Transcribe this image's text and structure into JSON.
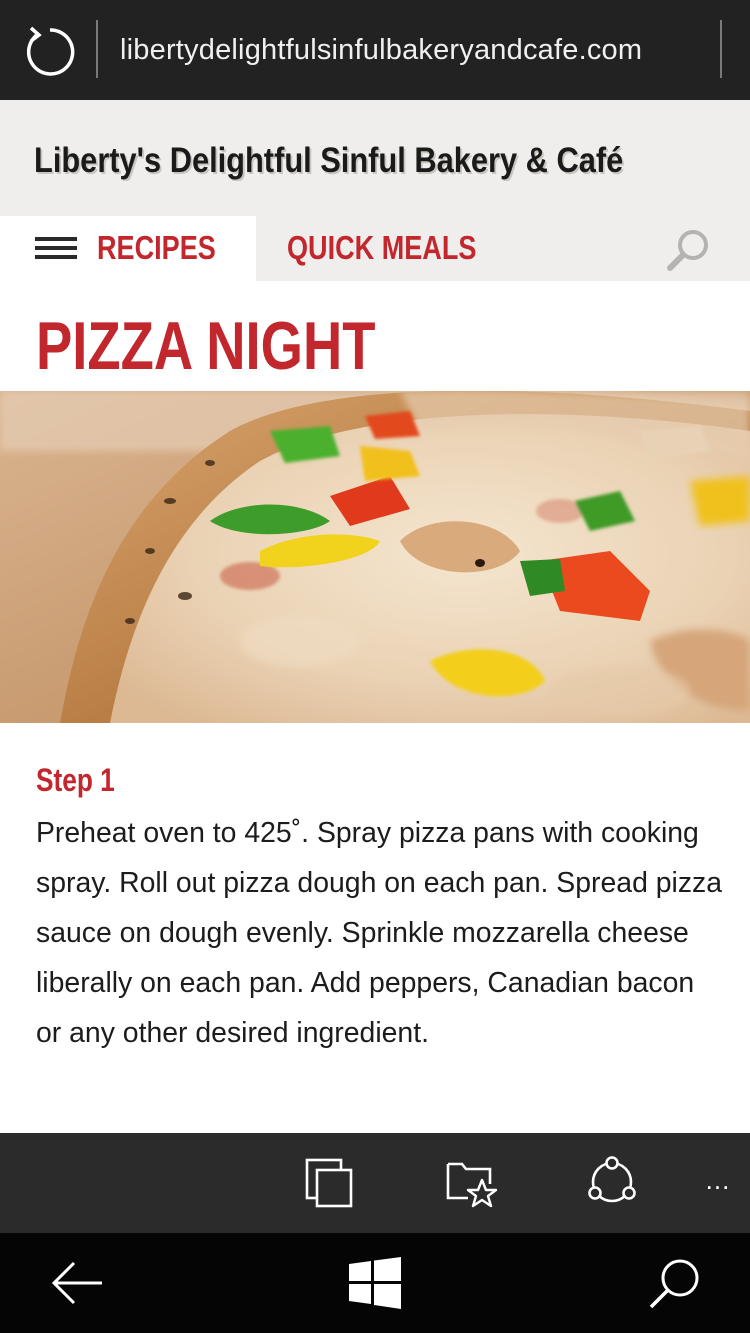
{
  "browser": {
    "url": "libertydelightfulsinfulbakeryandcafe.com"
  },
  "site": {
    "title": "Liberty's Delightful Sinful Bakery & Café"
  },
  "nav": {
    "items": [
      {
        "label": "RECIPES",
        "active": true
      },
      {
        "label": "QUICK MEALS",
        "active": false
      }
    ]
  },
  "page": {
    "title": "PIZZA NIGHT"
  },
  "steps": [
    {
      "heading": "Step 1",
      "text": "Preheat oven to 425˚. Spray pizza pans with cooking spray. Roll out pizza dough on each pan. Spread pizza sauce on dough evenly. Sprinkle mozzarella cheese liberally on each pan. Add peppers, Canadian bacon or any other desired ingredient."
    }
  ],
  "appbar": {
    "more_label": "..."
  },
  "icons": [
    "refresh-icon",
    "hamburger-menu-icon",
    "search-icon",
    "tabs-icon",
    "favorites-icon",
    "share-icon",
    "more-icon",
    "back-icon",
    "windows-start-icon",
    "cortana-search-icon"
  ],
  "colors": {
    "accent": "#c1272d",
    "header_bg": "#efeeec",
    "chrome_dark": "#222222",
    "appbar_bg": "#2b2b2b",
    "navbar_bg": "#050505"
  }
}
